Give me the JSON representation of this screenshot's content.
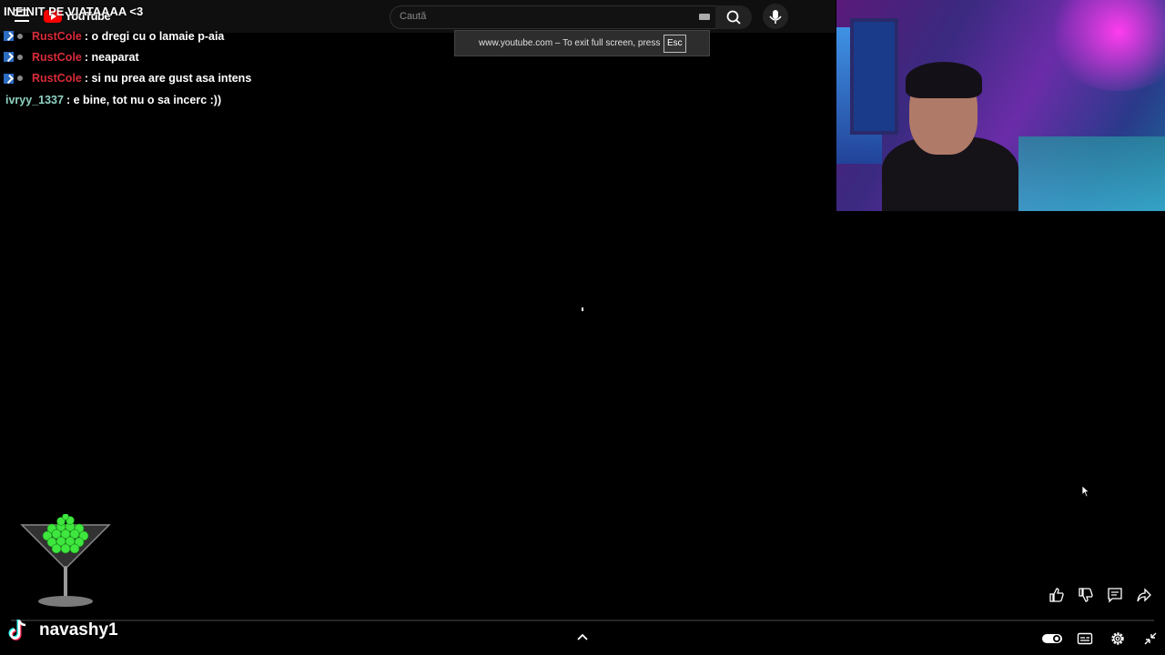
{
  "overlay_title": "INFINIT PE VIATAAAA <3",
  "youtube": {
    "logo_text": "YouTube",
    "search_placeholder": "Caută",
    "fullscreen_toast": "www.youtube.com – To exit full screen, press",
    "esc_key": "Esc"
  },
  "chat": [
    {
      "user": "RustCole",
      "text": ": o dregi cu o lamaie p-aia",
      "color": "#d92b3a",
      "badges": true
    },
    {
      "user": "RustCole",
      "text": ": neaparat",
      "color": "#d92b3a",
      "badges": true
    },
    {
      "user": "RustCole",
      "text": ": si nu prea are gust asa intens",
      "color": "#d92b3a",
      "badges": true
    },
    {
      "user": "ivryy_1337",
      "text": ": e bine, tot nu o sa incerc :))",
      "color": "#8fd3c3",
      "badges": false
    }
  ],
  "tiktok": {
    "username": "navashy1"
  },
  "icons": {
    "menu": "hamburger-icon",
    "search": "search-icon",
    "mic": "microphone-icon",
    "like": "thumbs-up-icon",
    "dislike": "thumbs-down-icon",
    "comment": "comment-icon",
    "share": "share-icon",
    "chevron": "chevron-up-icon",
    "autoplay": "autoplay-toggle-icon",
    "subtitles": "subtitles-icon",
    "settings": "gear-icon",
    "exit_fullscreen": "exit-fullscreen-icon"
  },
  "colors": {
    "accent_red": "#ff0000",
    "chat_red": "#d92b3a",
    "chat_teal": "#8fd3c3",
    "bead_green": "#3ee63e"
  }
}
